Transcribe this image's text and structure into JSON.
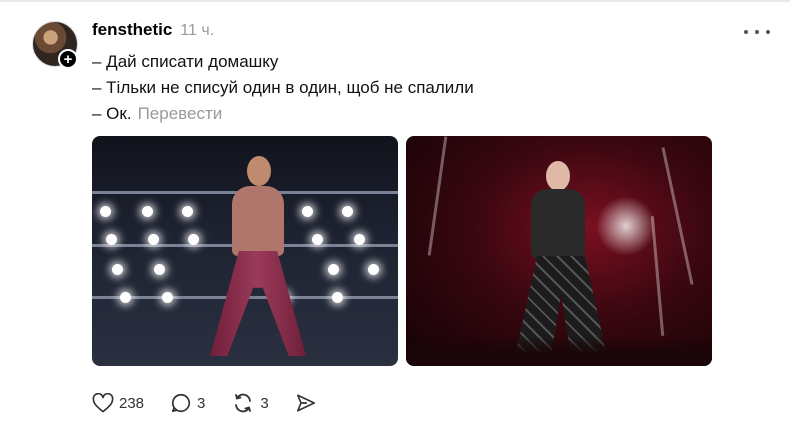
{
  "post": {
    "author": {
      "username": "fensthetic"
    },
    "timestamp": "11 ч.",
    "lines": [
      "– Дай списати домашку",
      "– Тільки не списуй один в один, щоб не спалили",
      "– Ок."
    ],
    "translate_label": "Перевести",
    "follow_symbol": "+",
    "images": [
      {
        "name": "photo-1"
      },
      {
        "name": "photo-2"
      }
    ]
  },
  "actions": {
    "like": {
      "icon": "heart-icon",
      "count": "238"
    },
    "reply": {
      "icon": "comment-icon",
      "count": "3"
    },
    "repost": {
      "icon": "repost-icon",
      "count": "3"
    },
    "share": {
      "icon": "share-icon"
    }
  },
  "colors": {
    "muted": "#999999",
    "text": "#111111",
    "badge": "#000000"
  }
}
